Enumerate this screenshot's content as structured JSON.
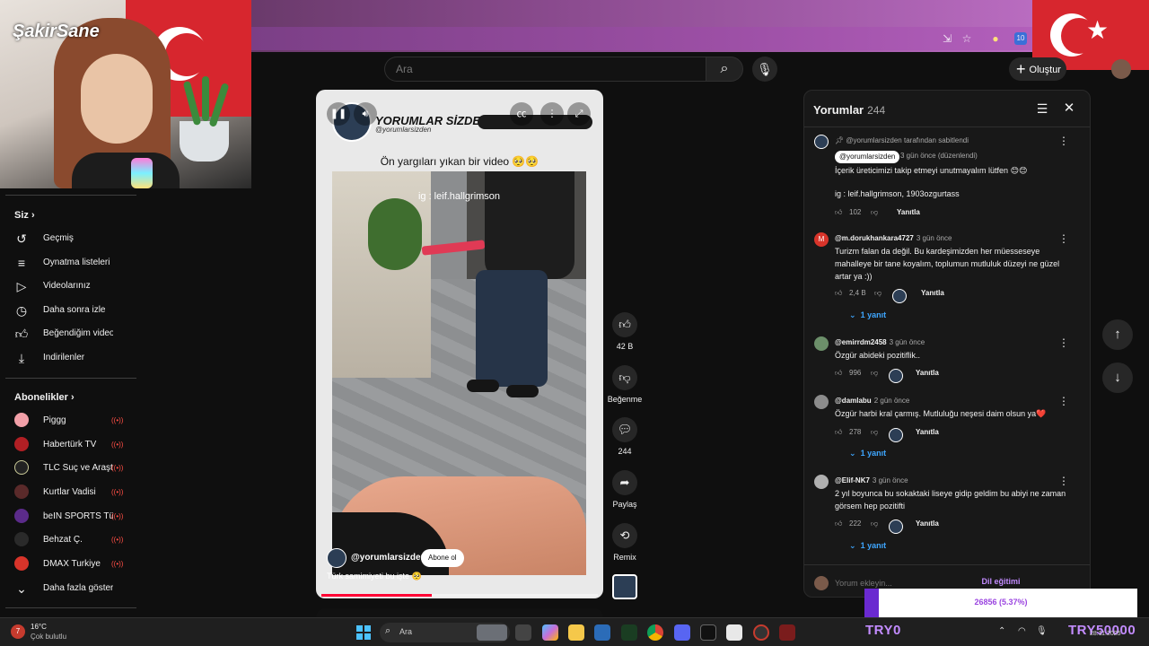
{
  "search": {
    "placeholder": "Ara"
  },
  "header": {
    "create_label": "Oluştur"
  },
  "webcam": {
    "logo_text": "ŞakirSane"
  },
  "sidebar": {
    "you_heading": "Siz",
    "items": [
      {
        "label": "Geçmiş",
        "icon": "history-icon"
      },
      {
        "label": "Oynatma listeleri",
        "icon": "playlist-icon"
      },
      {
        "label": "Videolarınız",
        "icon": "your-videos-icon"
      },
      {
        "label": "Daha sonra izle",
        "icon": "watch-later-icon"
      },
      {
        "label": "Beğendiğim videolar",
        "icon": "liked-icon"
      },
      {
        "label": "İndirilenler",
        "icon": "download-icon"
      }
    ],
    "subs_heading": "Abonelikler",
    "subscriptions": [
      {
        "label": "Piggg",
        "color": "#f2a0a8"
      },
      {
        "label": "Habertürk TV",
        "color": "#b11f24"
      },
      {
        "label": "TLC Suç ve Araşt...",
        "color": "#222222"
      },
      {
        "label": "Kurtlar Vadisi",
        "color": "#5a2a2a"
      },
      {
        "label": "beIN SPORTS Tü...",
        "color": "#5b2b8a"
      },
      {
        "label": "Behzat Ç.",
        "color": "#2a2a2a"
      },
      {
        "label": "DMAX Turkiye",
        "color": "#d8342a"
      }
    ],
    "show_more": "Daha fazla göster"
  },
  "player": {
    "header_title": "YORUMLAR SİZDEN",
    "header_handle": "@yorumlarsizden",
    "caption": "Ön yargıları yıkan bir video 🥺🥺",
    "ig_tag": "ig : leif.hallgrimson",
    "channel": "@yorumlarsizden",
    "subscribe_label": "Abone ol",
    "description": "Türk samimiyeti bu işte 🥺",
    "progress_fraction": 0.4
  },
  "actions": {
    "likes": "42 B",
    "dislike_label": "Beğenme",
    "comments": "244",
    "share_label": "Paylaş",
    "remix_label": "Remix"
  },
  "comments": {
    "title": "Yorumlar",
    "count": "244",
    "input_placeholder": "Yorum ekleyin...",
    "items": [
      {
        "pinned_by": "@yorumlarsizden tarafından sabitlendi",
        "author": "@yorumlarsizden",
        "time": "3 gün önce (düzenlendi)",
        "text": "İçerik üreticimizi takip etmeyi unutmayalım lütfen 😊😊",
        "text2": "ig : leif.hallgrimson, 1903ozgurtass",
        "likes": "102",
        "reply": "Yanıtla"
      },
      {
        "author": "@m.dorukhankara4727",
        "time": "3 gün önce",
        "text": "Turizm falan da değil. Bu kardeşimizden her müesseseye mahalleye bir tane koyalım, toplumun mutluluk düzeyi ne güzel artar ya :))",
        "likes": "2,4 B",
        "reply": "Yanıtla",
        "replies": "1 yanıt",
        "avatar_letter": "M"
      },
      {
        "author": "@emirrdm2458",
        "time": "3 gün önce",
        "text": "Özgür abideki pozitiflik..",
        "likes": "996",
        "reply": "Yanıtla"
      },
      {
        "author": "@damlabu",
        "time": "2 gün önce",
        "text": "Özgür harbi kral çarmış. Mutluluğu neşesi daim olsun ya❤️",
        "likes": "278",
        "reply": "Yanıtla",
        "replies": "1 yanıt"
      },
      {
        "author": "@Elif-NK7",
        "time": "3 gün önce",
        "text": "2 yıl boyunca bu sokaktaki liseye gidip geldim bu abiyi ne zaman görsem hep pozitifti",
        "likes": "222",
        "reply": "Yanıtla",
        "replies": "1 yanıt"
      }
    ]
  },
  "overlay": {
    "title": "Dil eğitimi",
    "value": "26856 (5.37%)"
  },
  "taskbar": {
    "weather_badge": "7",
    "temp": "16°C",
    "condition": "Çok bulutlu",
    "search_label": "Ara",
    "stream_left": "TRY0",
    "stream_right": "TRY50000",
    "date": "28.11.2025"
  }
}
